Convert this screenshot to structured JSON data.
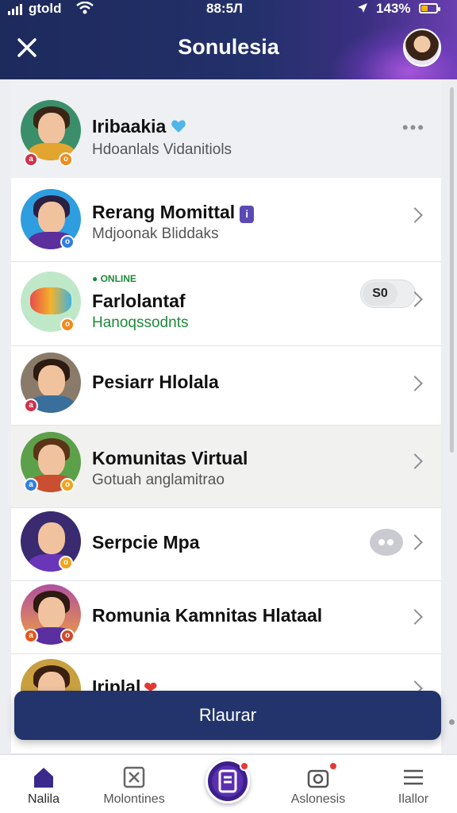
{
  "status_bar": {
    "carrier": "gtold",
    "time": "88:5Л",
    "battery": "143%"
  },
  "header": {
    "title": "Sonulesia"
  },
  "list": [
    {
      "name": "Iribaakia",
      "subtitle": "Hdoanlals Vidanitiols",
      "verified": true,
      "trailing": "more"
    },
    {
      "name": "Rerang Momittal",
      "subtitle": "Mdjoonak Bliddaks",
      "tag": "i",
      "trailing": "chevron"
    },
    {
      "name": "Farlolantaf",
      "subtitle": "Hanoqssodnts",
      "status": "ONLINE",
      "toggle_label": "S0",
      "trailing": "chevron"
    },
    {
      "name": "Pesiarr Hlolala",
      "subtitle": "",
      "trailing": "chevron"
    },
    {
      "name": "Komunitas Virtual",
      "subtitle": "Gotuah anglamitrao",
      "trailing": "chevron"
    },
    {
      "name": "Serpcie Mpa",
      "subtitle": "",
      "trailing": "chevron",
      "has_chat": true
    },
    {
      "name": "Romunia Kamnitas Hlataal",
      "subtitle": "",
      "trailing": "chevron"
    },
    {
      "name": "Iriplal",
      "subtitle": "",
      "trailing": "chevron",
      "heart": "❤"
    }
  ],
  "cta": {
    "label": "Rlaurar"
  },
  "tabs": [
    {
      "label": "Nalila",
      "icon": "home-icon",
      "active": true
    },
    {
      "label": "Molontines",
      "icon": "close-box-icon"
    },
    {
      "label": "",
      "icon": "center-action-icon"
    },
    {
      "label": "Aslonesis",
      "icon": "camera-icon"
    },
    {
      "label": "Ilallor",
      "icon": "menu-icon"
    }
  ],
  "colors": {
    "header_bg": "#1d2a5c",
    "accent": "#22346b",
    "online": "#1f8a3a",
    "notif": "#e53935"
  }
}
